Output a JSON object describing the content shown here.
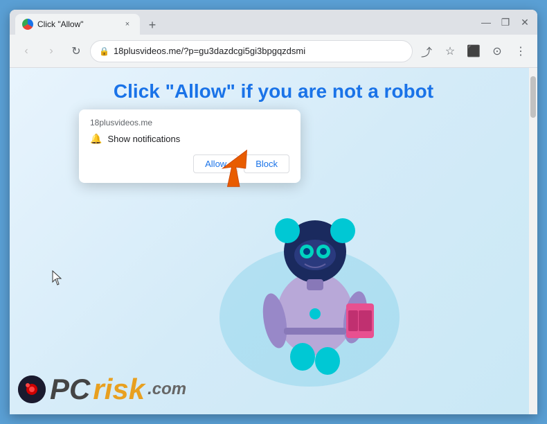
{
  "browser": {
    "tab": {
      "favicon_aria": "globe-icon",
      "title": "Click \"Allow\"",
      "close_label": "×",
      "new_tab_label": "+"
    },
    "window_controls": {
      "maximize": "❐",
      "minimize": "—",
      "close": "✕",
      "menu": "⋮"
    },
    "nav": {
      "back_label": "‹",
      "forward_label": "›",
      "reload_label": "↻",
      "lock_icon": "🔒",
      "url": "18plusvideos.me/?p=gu3dazdcgi5gi3bpgqzdsmi",
      "share_icon": "⬆",
      "bookmark_icon": "☆",
      "extensions_icon": "⬛",
      "profile_icon": "⊙",
      "more_icon": "⋮"
    }
  },
  "page": {
    "headline": "Click \"Allow\" if you are not a robot",
    "headline_color": "#1a73e8"
  },
  "notification_popup": {
    "site_name": "18plusvideos.me",
    "show_notifications_label": "Show notifications",
    "allow_button": "Allow",
    "block_button": "Block"
  },
  "watermark": {
    "brand_pc": "PC",
    "brand_risk": "risk",
    "brand_com": ".com"
  },
  "colors": {
    "browser_bg": "#dee1e6",
    "content_bg": "#ffffff",
    "accent": "#1a73e8",
    "popup_bg": "#ffffff"
  }
}
